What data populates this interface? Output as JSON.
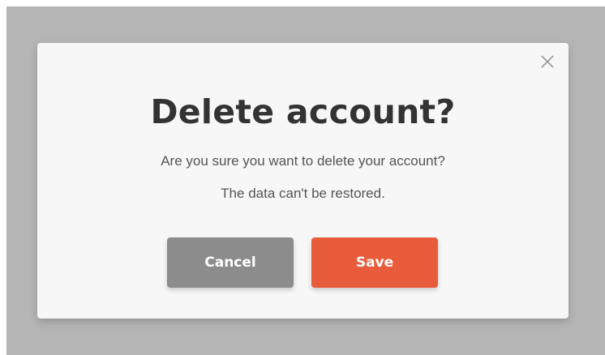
{
  "dialog": {
    "title": "Delete account?",
    "message_line1": "Are you sure you want to delete your account?",
    "message_line2": "The data can't be restored.",
    "close_icon": "close-icon",
    "cancel_label": "Cancel",
    "save_label": "Save"
  },
  "colors": {
    "overlay": "#b5b5b5",
    "dialog_background": "#f7f7f7",
    "title": "#333333",
    "cancel_button": "#8c8c8c",
    "save_button": "#e85c3c"
  }
}
